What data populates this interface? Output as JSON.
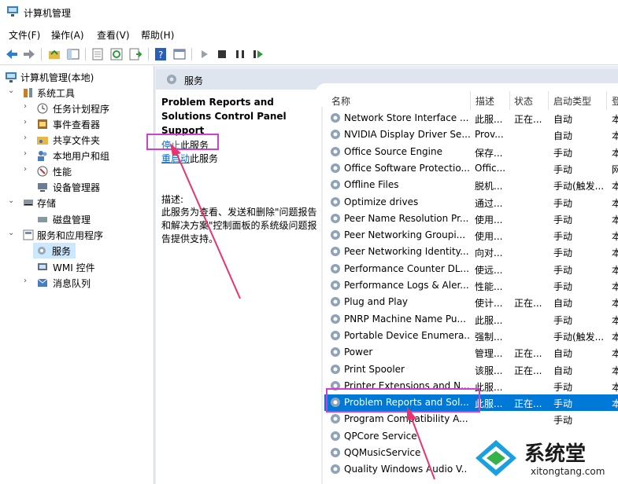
{
  "window": {
    "title": "计算机管理"
  },
  "menu": [
    "文件(F)",
    "操作(A)",
    "查看(V)",
    "帮助(H)"
  ],
  "tree": {
    "root": "计算机管理(本地)",
    "system_tools": "系统工具",
    "task_scheduler": "任务计划程序",
    "event_viewer": "事件查看器",
    "shared_folders": "共享文件夹",
    "local_users": "本地用户和组",
    "performance": "性能",
    "device_manager": "设备管理器",
    "storage": "存储",
    "disk_management": "磁盘管理",
    "services_apps": "服务和应用程序",
    "services": "服务",
    "wmi": "WMI 控件",
    "message_queue": "消息队列"
  },
  "pane": {
    "header": "服务",
    "service_title": "Problem Reports and Solutions Control Panel Support",
    "stop_link": "停止",
    "stop_suffix": "此服务",
    "restart_link": "重启动",
    "restart_suffix": "此服务",
    "desc_label": "描述:",
    "desc_text": "此服务为查看、发送和删除\"问题报告和解决方案\"控制面板的系统级问题报告提供支持。"
  },
  "columns": {
    "name": "名称",
    "desc": "描述",
    "status": "状态",
    "startup": "启动类型",
    "logon": "登"
  },
  "services": [
    {
      "name": "Network Store Interface ...",
      "desc": "此服...",
      "status": "正在...",
      "startup": "自动",
      "logon": "本"
    },
    {
      "name": "NVIDIA Display Driver Se...",
      "desc": "Prov...",
      "status": "",
      "startup": "自动",
      "logon": "本"
    },
    {
      "name": "Office  Source Engine",
      "desc": "保存...",
      "status": "",
      "startup": "手动",
      "logon": "本"
    },
    {
      "name": "Office Software Protectio...",
      "desc": "Offic...",
      "status": "",
      "startup": "手动",
      "logon": "网"
    },
    {
      "name": "Offline Files",
      "desc": "脱机...",
      "status": "",
      "startup": "手动(触发...",
      "logon": "本"
    },
    {
      "name": "Optimize drives",
      "desc": "通过...",
      "status": "",
      "startup": "手动",
      "logon": "本"
    },
    {
      "name": "Peer Name Resolution Pr...",
      "desc": "使用...",
      "status": "",
      "startup": "手动",
      "logon": "本"
    },
    {
      "name": "Peer Networking Groupi...",
      "desc": "使用...",
      "status": "",
      "startup": "手动",
      "logon": "本"
    },
    {
      "name": "Peer Networking Identity...",
      "desc": "向对...",
      "status": "",
      "startup": "手动",
      "logon": "本"
    },
    {
      "name": "Performance Counter DL...",
      "desc": "使远...",
      "status": "",
      "startup": "手动",
      "logon": "本"
    },
    {
      "name": "Performance Logs & Aler...",
      "desc": "性能...",
      "status": "",
      "startup": "手动",
      "logon": "本"
    },
    {
      "name": "Plug and Play",
      "desc": "使计...",
      "status": "正在...",
      "startup": "自动",
      "logon": "本"
    },
    {
      "name": "PNRP Machine Name Pu...",
      "desc": "此服...",
      "status": "",
      "startup": "手动",
      "logon": "本"
    },
    {
      "name": "Portable Device Enumera...",
      "desc": "强制...",
      "status": "",
      "startup": "手动(触发...",
      "logon": "本"
    },
    {
      "name": "Power",
      "desc": "管理...",
      "status": "正在...",
      "startup": "自动",
      "logon": "本"
    },
    {
      "name": "Print Spooler",
      "desc": "该服...",
      "status": "正在...",
      "startup": "自动",
      "logon": "本"
    },
    {
      "name": "Printer Extensions and N...",
      "desc": "此服...",
      "status": "",
      "startup": "手动",
      "logon": "本"
    },
    {
      "name": "Problem Reports and Sol...",
      "desc": "此服...",
      "status": "正在...",
      "startup": "手动",
      "logon": "本",
      "selected": true
    },
    {
      "name": "Program Compatibility A...",
      "desc": "",
      "status": "",
      "startup": "手动",
      "logon": ""
    },
    {
      "name": "QPCore Service",
      "desc": "",
      "status": "",
      "startup": "",
      "logon": ""
    },
    {
      "name": "QQMusicService",
      "desc": "",
      "status": "",
      "startup": "",
      "logon": ""
    },
    {
      "name": "Quality Windows Audio V...",
      "desc": "",
      "status": "",
      "startup": "",
      "logon": ""
    }
  ],
  "watermark": {
    "brand": "系统堂",
    "url": "xitongtang.com"
  },
  "colors": {
    "selection": "#0078d7",
    "annotation": "#d040d0",
    "arrow": "#e8336e",
    "link": "#0066cc"
  }
}
